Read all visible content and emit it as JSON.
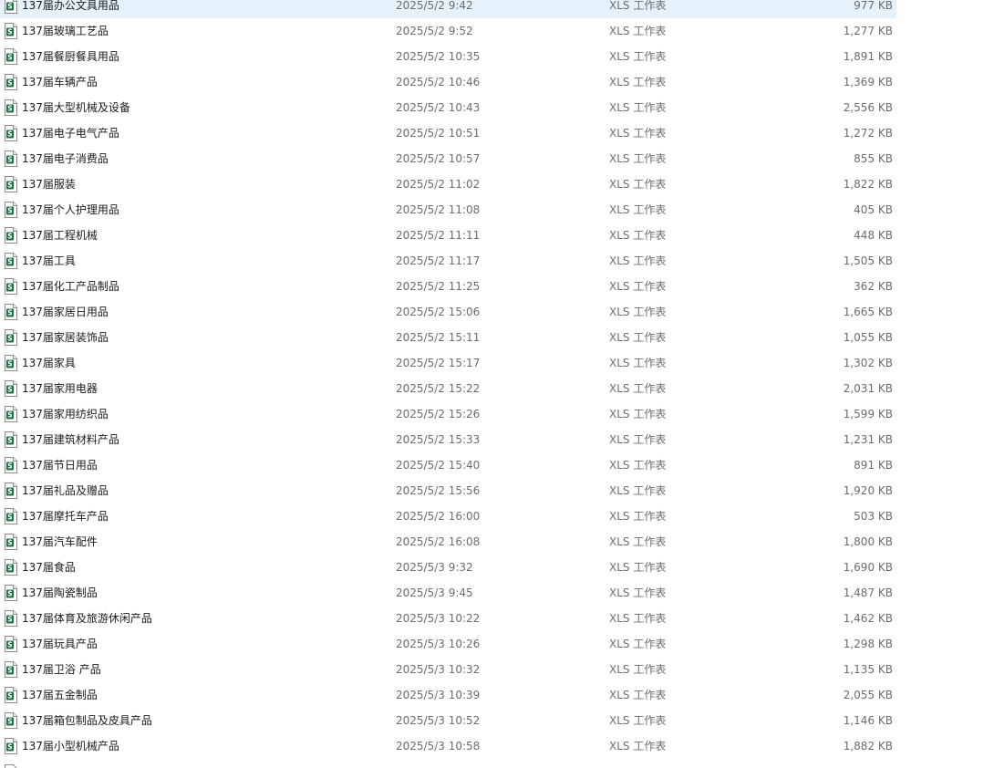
{
  "colors": {
    "selected_row": "#e5f1fb",
    "meta_text": "#6d6d6d",
    "icon_green": "#1e7145"
  },
  "files": [
    {
      "name": "137届办公文具用品",
      "date": "2025/5/2 9:42",
      "type": "XLS 工作表",
      "size": "977 KB",
      "selected": true
    },
    {
      "name": "137届玻璃工艺品",
      "date": "2025/5/2 9:52",
      "type": "XLS 工作表",
      "size": "1,277 KB"
    },
    {
      "name": "137届餐厨餐具用品",
      "date": "2025/5/2 10:35",
      "type": "XLS 工作表",
      "size": "1,891 KB"
    },
    {
      "name": "137届车辆产品",
      "date": "2025/5/2 10:46",
      "type": "XLS 工作表",
      "size": "1,369 KB"
    },
    {
      "name": "137届大型机械及设备",
      "date": "2025/5/2 10:43",
      "type": "XLS 工作表",
      "size": "2,556 KB"
    },
    {
      "name": "137届电子电气产品",
      "date": "2025/5/2 10:51",
      "type": "XLS 工作表",
      "size": "1,272 KB"
    },
    {
      "name": "137届电子消费品",
      "date": "2025/5/2 10:57",
      "type": "XLS 工作表",
      "size": "855 KB"
    },
    {
      "name": "137届服装",
      "date": "2025/5/2 11:02",
      "type": "XLS 工作表",
      "size": "1,822 KB"
    },
    {
      "name": "137届个人护理用品",
      "date": "2025/5/2 11:08",
      "type": "XLS 工作表",
      "size": "405 KB"
    },
    {
      "name": "137届工程机械",
      "date": "2025/5/2 11:11",
      "type": "XLS 工作表",
      "size": "448 KB"
    },
    {
      "name": "137届工具",
      "date": "2025/5/2 11:17",
      "type": "XLS 工作表",
      "size": "1,505 KB"
    },
    {
      "name": "137届化工产品制品",
      "date": "2025/5/2 11:25",
      "type": "XLS 工作表",
      "size": "362 KB"
    },
    {
      "name": "137届家居日用品",
      "date": "2025/5/2 15:06",
      "type": "XLS 工作表",
      "size": "1,665 KB"
    },
    {
      "name": "137届家居装饰品",
      "date": "2025/5/2 15:11",
      "type": "XLS 工作表",
      "size": "1,055 KB"
    },
    {
      "name": "137届家具",
      "date": "2025/5/2 15:17",
      "type": "XLS 工作表",
      "size": "1,302 KB"
    },
    {
      "name": "137届家用电器",
      "date": "2025/5/2 15:22",
      "type": "XLS 工作表",
      "size": "2,031 KB"
    },
    {
      "name": "137届家用纺织品",
      "date": "2025/5/2 15:26",
      "type": "XLS 工作表",
      "size": "1,599 KB"
    },
    {
      "name": "137届建筑材料产品",
      "date": "2025/5/2 15:33",
      "type": "XLS 工作表",
      "size": "1,231 KB"
    },
    {
      "name": "137届节日用品",
      "date": "2025/5/2 15:40",
      "type": "XLS 工作表",
      "size": "891 KB"
    },
    {
      "name": "137届礼品及赠品",
      "date": "2025/5/2 15:56",
      "type": "XLS 工作表",
      "size": "1,920 KB"
    },
    {
      "name": "137届摩托车产品",
      "date": "2025/5/2 16:00",
      "type": "XLS 工作表",
      "size": "503 KB"
    },
    {
      "name": "137届汽车配件",
      "date": "2025/5/2 16:08",
      "type": "XLS 工作表",
      "size": "1,800 KB"
    },
    {
      "name": "137届食品",
      "date": "2025/5/3 9:32",
      "type": "XLS 工作表",
      "size": "1,690 KB"
    },
    {
      "name": "137届陶瓷制品",
      "date": "2025/5/3 9:45",
      "type": "XLS 工作表",
      "size": "1,487 KB"
    },
    {
      "name": "137届体育及旅游休闲产品",
      "date": "2025/5/3 10:22",
      "type": "XLS 工作表",
      "size": "1,462 KB"
    },
    {
      "name": "137届玩具产品",
      "date": "2025/5/3 10:26",
      "type": "XLS 工作表",
      "size": "1,298 KB"
    },
    {
      "name": "137届卫浴 产品",
      "date": "2025/5/3 10:32",
      "type": "XLS 工作表",
      "size": "1,135 KB"
    },
    {
      "name": "137届五金制品",
      "date": "2025/5/3 10:39",
      "type": "XLS 工作表",
      "size": "2,055 KB"
    },
    {
      "name": "137届箱包制品及皮具产品",
      "date": "2025/5/3 10:52",
      "type": "XLS 工作表",
      "size": "1,146 KB"
    },
    {
      "name": "137届小型机械产品",
      "date": "2025/5/3 10:58",
      "type": "XLS 工作表",
      "size": "1,882 KB"
    }
  ],
  "icon_name": "xls-file-icon"
}
